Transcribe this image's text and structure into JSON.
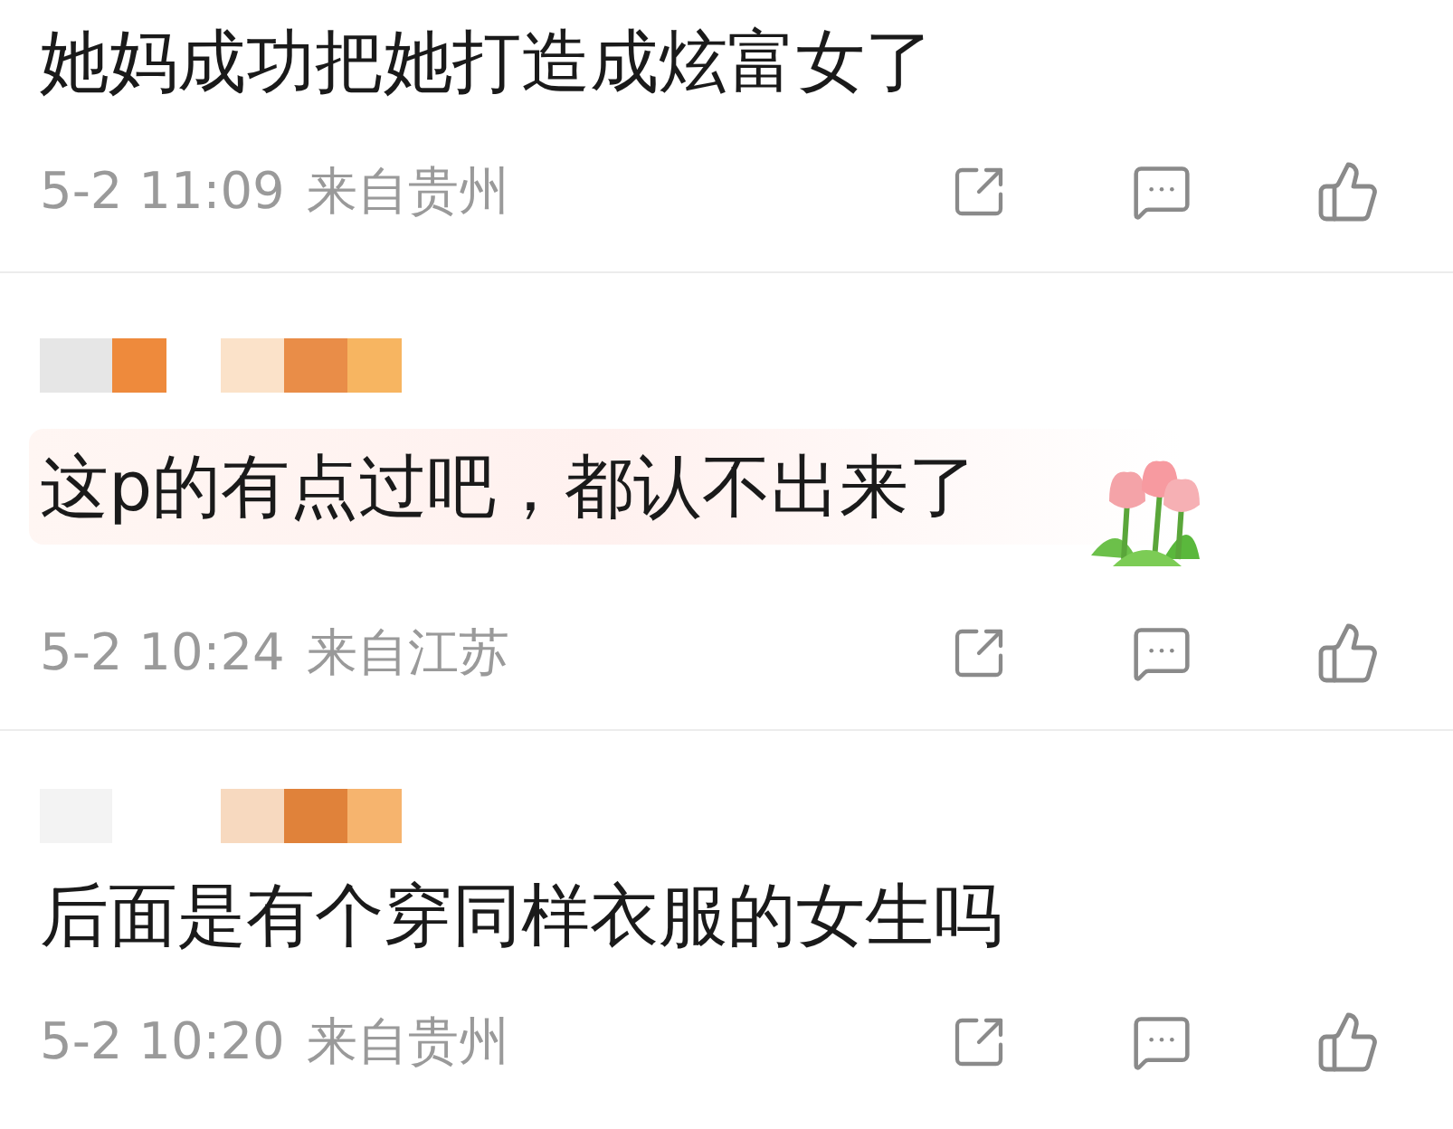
{
  "comments": [
    {
      "kind": "cut",
      "decorated": false,
      "text": "她妈成功把她打造成炫富女了",
      "time": "5-2 11:09",
      "location": "来自贵州"
    },
    {
      "kind": "full",
      "decorated": true,
      "text": "这p的有点过吧，都认不出来了",
      "time": "5-2 10:24",
      "location": "来自江苏"
    },
    {
      "kind": "full",
      "decorated": false,
      "text": "后面是有个穿同样衣服的女生吗",
      "time": "5-2 10:20",
      "location": "来自贵州"
    }
  ]
}
